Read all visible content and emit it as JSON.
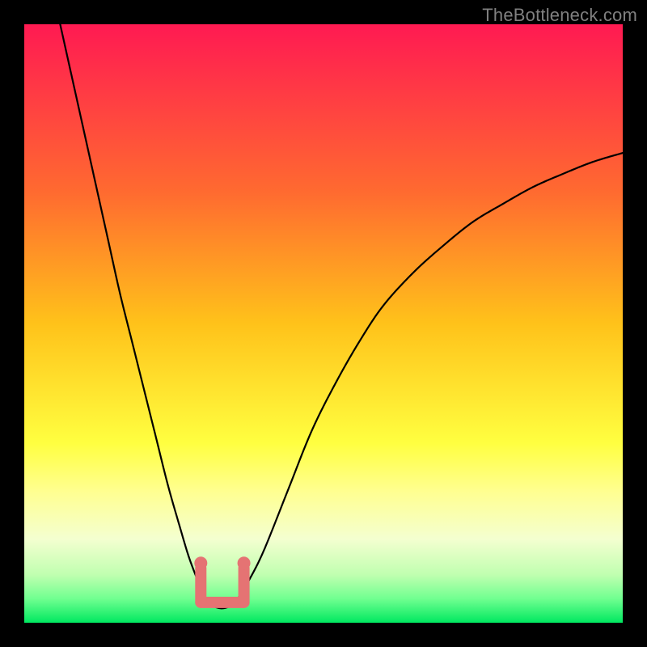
{
  "watermark": "TheBottleneck.com",
  "colors": {
    "background": "#000000",
    "gradient_top": "#ff1a52",
    "gradient_mid_upper": "#ff7a30",
    "gradient_mid": "#ffd21a",
    "gradient_mid_lower": "#ffff66",
    "gradient_lower": "#e9ffb0",
    "gradient_bottom": "#00ff66",
    "curve": "#000000",
    "marker_fill": "#e57373",
    "marker_stroke": "#e57373"
  },
  "chart_data": {
    "type": "line",
    "title": "",
    "xlabel": "",
    "ylabel": "",
    "xlim": [
      0,
      100
    ],
    "ylim": [
      0,
      100
    ],
    "grid": false,
    "legend": false,
    "gradient_stops": [
      {
        "offset": 0.0,
        "color": "#ff1a52"
      },
      {
        "offset": 0.28,
        "color": "#ff6a30"
      },
      {
        "offset": 0.5,
        "color": "#ffc21a"
      },
      {
        "offset": 0.7,
        "color": "#ffff40"
      },
      {
        "offset": 0.78,
        "color": "#ffff90"
      },
      {
        "offset": 0.86,
        "color": "#f4ffd0"
      },
      {
        "offset": 0.92,
        "color": "#c0ffb0"
      },
      {
        "offset": 0.96,
        "color": "#70ff90"
      },
      {
        "offset": 1.0,
        "color": "#00e860"
      }
    ],
    "series": [
      {
        "name": "bottleneck-curve",
        "x": [
          6,
          8,
          10,
          12,
          14,
          16,
          18,
          20,
          22,
          24,
          26,
          27.5,
          29,
          30,
          31,
          32,
          33,
          34,
          35,
          36,
          37.5,
          40,
          44,
          48,
          52,
          56,
          60,
          65,
          70,
          75,
          80,
          85,
          90,
          95,
          100
        ],
        "y": [
          100,
          91,
          82,
          73,
          64,
          55,
          47,
          39,
          31,
          23,
          16,
          11,
          7,
          4.5,
          3.2,
          2.6,
          2.4,
          2.6,
          3.2,
          4.5,
          7,
          12,
          22,
          32,
          40,
          47,
          53,
          58.5,
          63,
          67,
          70,
          72.8,
          75,
          77,
          78.5
        ]
      }
    ],
    "flat_valley": {
      "x_start": 30,
      "x_end": 36,
      "y": 2.4
    },
    "markers": [
      {
        "shape": "person",
        "x": 29.5,
        "y_top": 10.5,
        "y_bottom": 3.4,
        "note": "left valley marker"
      },
      {
        "shape": "person",
        "x": 36.7,
        "y_top": 10.5,
        "y_bottom": 3.4,
        "note": "right valley marker"
      }
    ],
    "valley_bar": {
      "x_start": 29.5,
      "x_end": 36.7,
      "y": 3.4
    }
  }
}
